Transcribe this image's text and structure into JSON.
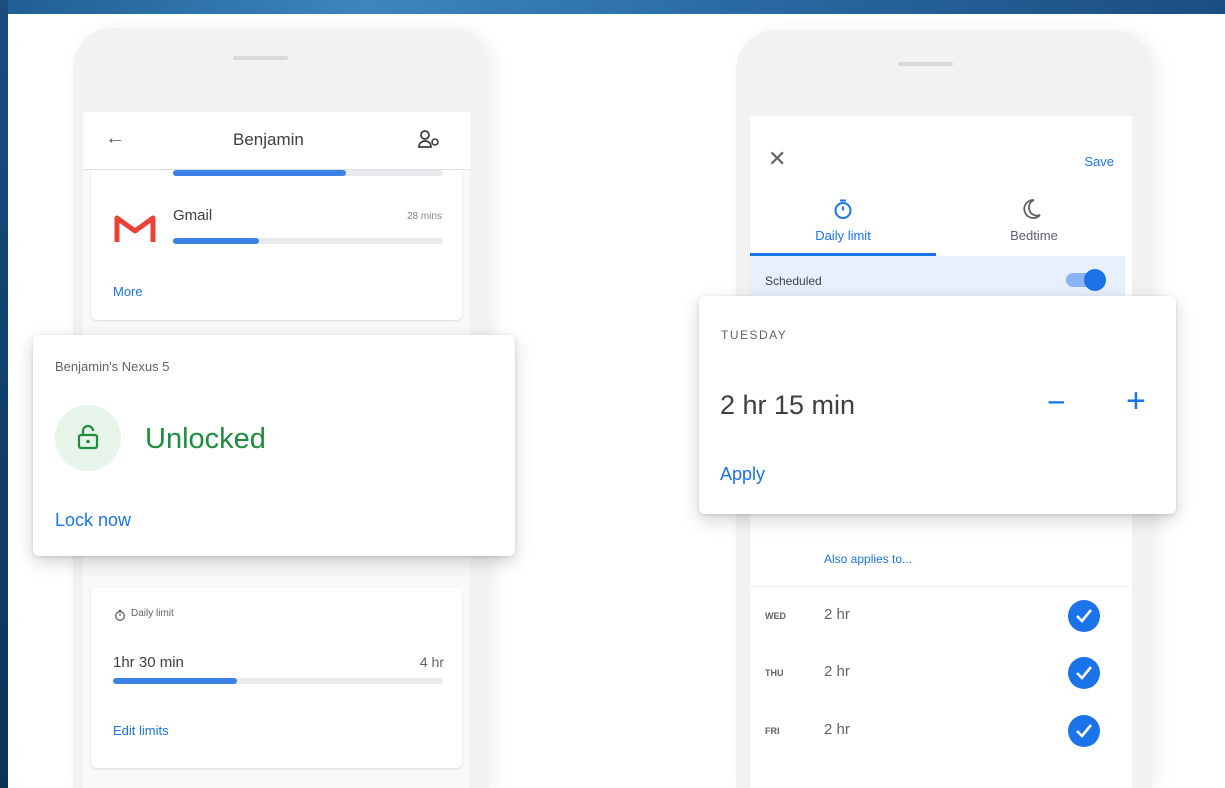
{
  "left_phone": {
    "header": {
      "title": "Benjamin"
    },
    "gmail": {
      "name": "Gmail",
      "time": "28 mins",
      "usage_fraction": 0.32
    },
    "partial_app_usage_fraction": 0.64,
    "more_label": "More",
    "device_card": {
      "device_name": "Benjamin's Nexus 5",
      "status": "Unlocked",
      "action": "Lock now"
    },
    "daily_limit": {
      "label": "Daily limit",
      "used": "1hr 30 min",
      "limit": "4 hr",
      "usage_fraction": 0.375,
      "edit_label": "Edit limits"
    }
  },
  "right_phone": {
    "save_label": "Save",
    "tabs": [
      {
        "label": "Daily limit",
        "selected": true
      },
      {
        "label": "Bedtime",
        "selected": false
      }
    ],
    "scheduled": {
      "label": "Scheduled",
      "on": true
    },
    "day_card": {
      "day": "TUESDAY",
      "time": "2 hr 15 min",
      "minus": "−",
      "plus": "+",
      "apply_label": "Apply"
    },
    "also_applies": "Also applies to...",
    "days": [
      {
        "day": "WED",
        "time": "2 hr",
        "checked": true
      },
      {
        "day": "THU",
        "time": "2 hr",
        "checked": true
      },
      {
        "day": "FRI",
        "time": "2 hr",
        "checked": true
      }
    ]
  },
  "colors": {
    "accent": "#1a73e8",
    "unlocked_green": "#1e8e3e",
    "unlocked_circle": "#e6f4ea",
    "gmail_red": "#ea4335"
  }
}
